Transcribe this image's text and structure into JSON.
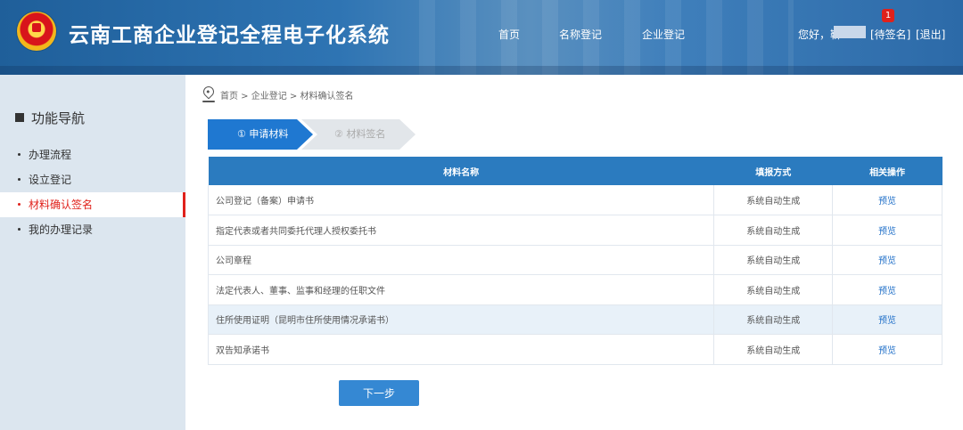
{
  "header": {
    "title": "云南工商企业登记全程电子化系统",
    "nav": [
      "首页",
      "名称登记",
      "企业登记"
    ],
    "greeting": "您好，靳",
    "pending_label": "[待签名]",
    "pending_count": "1",
    "logout_label": "[退出]"
  },
  "sidebar": {
    "title": "功能导航",
    "items": [
      {
        "label": "办理流程",
        "active": false
      },
      {
        "label": "设立登记",
        "active": false
      },
      {
        "label": "材料确认签名",
        "active": true
      },
      {
        "label": "我的办理记录",
        "active": false
      }
    ]
  },
  "breadcrumb": "首页 > 企业登记 > 材料确认签名",
  "steps": [
    {
      "label": "① 申请材料",
      "active": true
    },
    {
      "label": "② 材料签名",
      "active": false
    }
  ],
  "table": {
    "headers": [
      "材料名称",
      "填报方式",
      "相关操作"
    ],
    "rows": [
      {
        "name": "公司登记（备案）申请书",
        "mode": "系统自动生成",
        "action": "预览"
      },
      {
        "name": "指定代表或者共同委托代理人授权委托书",
        "mode": "系统自动生成",
        "action": "预览"
      },
      {
        "name": "公司章程",
        "mode": "系统自动生成",
        "action": "预览"
      },
      {
        "name": "法定代表人、董事、监事和经理的任职文件",
        "mode": "系统自动生成",
        "action": "预览"
      },
      {
        "name": "住所使用证明（昆明市住所使用情况承诺书）",
        "mode": "系统自动生成",
        "action": "预览"
      },
      {
        "name": "双告知承诺书",
        "mode": "系统自动生成",
        "action": "预览"
      }
    ]
  },
  "next_button": "下一步",
  "colors": {
    "header": "#2e74b3",
    "accent": "#1f78d1",
    "active_nav": "#e0211b"
  }
}
